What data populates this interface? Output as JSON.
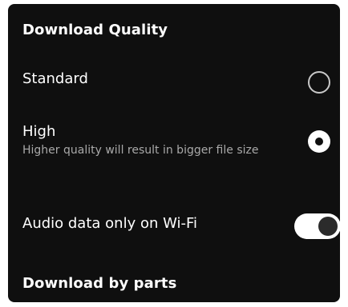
{
  "download_quality": {
    "title": "Download Quality",
    "options": [
      {
        "label": "Standard",
        "subtitle": "",
        "selected": false
      },
      {
        "label": "High",
        "subtitle": "Higher quality will result in bigger file size",
        "selected": true
      }
    ]
  },
  "audio_wifi": {
    "label": "Audio data only on Wi-Fi",
    "enabled": true
  },
  "download_by_parts": {
    "title": "Download by parts"
  },
  "colors": {
    "background": "#0f0f0f",
    "text": "#ffffff",
    "subtext": "#a9a9a9"
  }
}
